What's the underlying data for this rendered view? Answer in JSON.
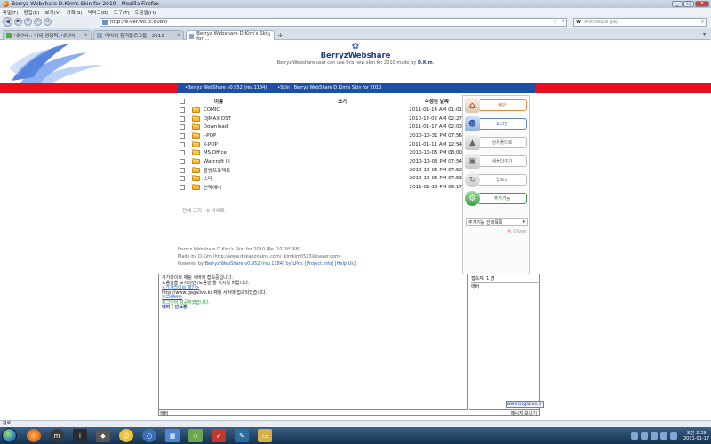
{
  "window": {
    "title": "Berryz Webshare D.Kim's Skin for 2010 - Mozilla Firefox",
    "min": "_",
    "max": "□",
    "close": "✕"
  },
  "menu": [
    "파일(F)",
    "편집(E)",
    "보기(V)",
    "기록(S)",
    "북마크(B)",
    "도구(T)",
    "도움말(H)"
  ],
  "nav": {
    "back": "◀",
    "forward": "▶",
    "reload": "↻",
    "stop": "✕",
    "home": "⌂",
    "url": "http://e-ver.wo.tc:8080/",
    "star": "☆",
    "dropdown": "▾",
    "search_engine": "W",
    "search_placeholder": "Wikipedia (ja)",
    "search_icon": "⌕"
  },
  "tabs": [
    {
      "label": "네이버 :: 나의 경쟁력, 네이버",
      "close": "✕"
    },
    {
      "label": "메버의 장겨블로그들 - 2011",
      "close": "✕"
    },
    {
      "label": "Berryz Webshare D.Kim's Skin for ...",
      "close": "✕"
    }
  ],
  "tab_new": "+",
  "tab_list": "▾",
  "header": {
    "brand_name": "BerryzWebshare",
    "tagline_pre": "Berryz Webshare user can use this new skin for 2010 made by ",
    "tagline_author": "D.Kim",
    "tagline_post": "."
  },
  "bluebar": {
    "item1": "•Berryz WebShare v0.952 (rev.1184)",
    "item2": "•Skin : Berryz WebShare D.Kim's Skin for 2010"
  },
  "files": {
    "columns": {
      "name": "이름",
      "size": "크기",
      "date": "수정된 날짜"
    },
    "rows": [
      {
        "name": "COMIC",
        "date": "2011-01-14 AM 01:01"
      },
      {
        "name": "DJMAX OST",
        "date": "2010-12-02 AM 02:27"
      },
      {
        "name": "Download",
        "date": "2011-01-17 AM 02:03"
      },
      {
        "name": "J-POP",
        "date": "2010-10-31 PM 07:56"
      },
      {
        "name": "K-POP",
        "date": "2011-01-11 AM 12:54"
      },
      {
        "name": "MS Office",
        "date": "2010-10-05 PM 08:00"
      },
      {
        "name": "Warcraft III",
        "date": "2010-10-05 PM 07:54"
      },
      {
        "name": "롤방프로젝트",
        "date": "2010-10-05 PM 07:52"
      },
      {
        "name": "스타",
        "date": "2010-10-05 PM 07:53"
      },
      {
        "name": "신작애니",
        "date": "2011-01-16 PM 09:17"
      }
    ],
    "total": "전체 크기 : 0 바이트"
  },
  "sidebar": {
    "home": "메인",
    "login": "로그인",
    "upload": "상위폴더로",
    "newfolder": "새폴더추가",
    "refresh": "업로드",
    "addfunc": "추가기능",
    "addfunc_select": "추가기능 선택목록",
    "close": "Close",
    "close_icon": "✕"
  },
  "footer": {
    "line1": "Berryz Webshare D.Kim's Skin for 2010 (Re. 1029*768)",
    "line2": "Made by D.Kim (http://www.dekaponainu.com/, kimkim0513@naver.com)",
    "line3_pre": "Powered by ",
    "line3_link1": "Berryz WebShare v0.952 (rev.1184)",
    "line3_mid": " by ",
    "line3_link2": "LPro. [Project.Info]",
    "line3_link3": "[Help Us]"
  },
  "chat": {
    "lines": [
      {
        "text": "가가라이브 채팅 서버에 접속중입니다.",
        "cls": ""
      },
      {
        "text": "도움말을 보시려면 /도움말 을 치시길 바랍니다.",
        "cls": ""
      },
      {
        "text": "<가가라이브 패인>",
        "cls": "g u"
      },
      {
        "text": "http://www.gagalive.kr 채팅 서버에 접속되었습니다.",
        "cls": ""
      },
      {
        "text": "조모태버란",
        "cls": "g u"
      },
      {
        "text": "로그인이 성공하였습니다.",
        "cls": "g"
      },
      {
        "text": "에버 : 안뇨뇽",
        "cls": "b"
      }
    ],
    "users_count": "접속자: 1 명",
    "users": [
      "에버"
    ],
    "input": "에버",
    "send": "메시지 보내기",
    "link": "www.GagaLive.kr"
  },
  "status": "완료",
  "clock": {
    "time": "오전 2:39",
    "date": "2011-01-17"
  },
  "colors": {
    "red": "#e5101c",
    "blue": "#1e4fa8"
  }
}
